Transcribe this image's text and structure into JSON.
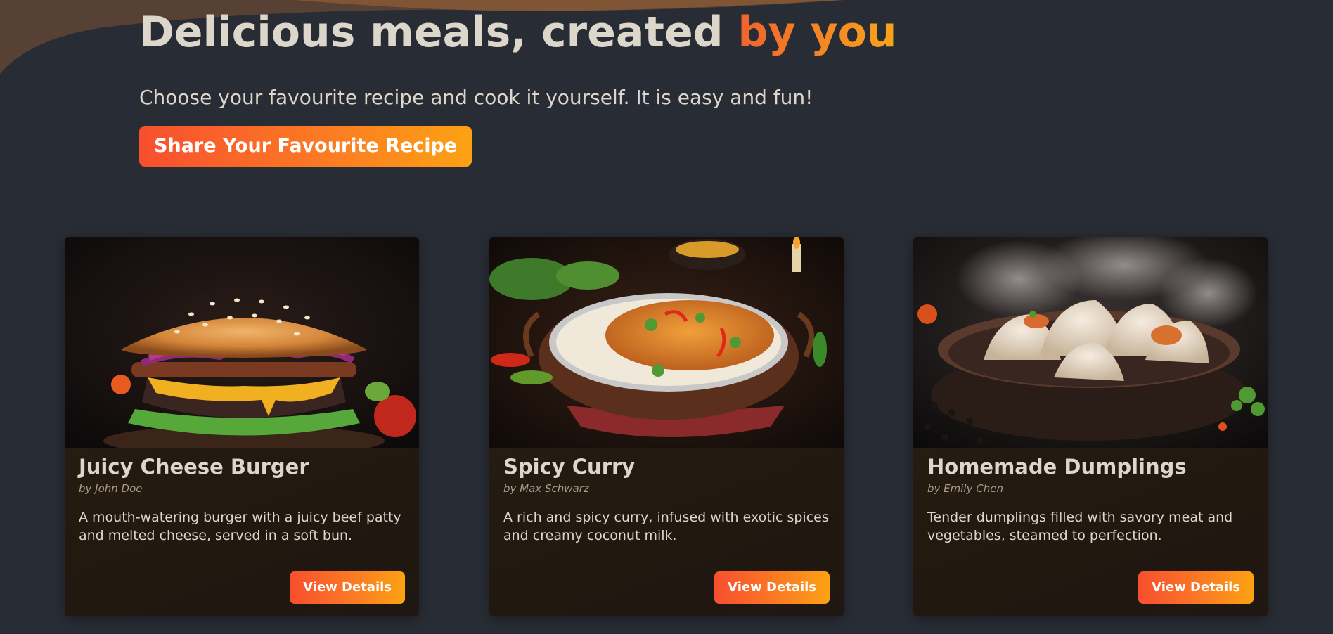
{
  "hero": {
    "title_main": "Delicious meals, created ",
    "title_accent": "by you",
    "subtitle": "Choose your favourite recipe and cook it yourself. It is easy and fun!",
    "cta_label": "Share Your Favourite Recipe"
  },
  "colors": {
    "background": "#282c34",
    "text": "#ddd6cb",
    "accent_start": "#f84f2f",
    "accent_end": "#fca213",
    "wave": "#5a4236"
  },
  "recipes": [
    {
      "title": "Juicy Cheese Burger",
      "author": "by John Doe",
      "description": "A mouth-watering burger with a juicy beef patty and melted cheese, served in a soft bun.",
      "button_label": "View Details",
      "image": "burger-photo"
    },
    {
      "title": "Spicy Curry",
      "author": "by Max Schwarz",
      "description": "A rich and spicy curry, infused with exotic spices and creamy coconut milk.",
      "button_label": "View Details",
      "image": "curry-photo"
    },
    {
      "title": "Homemade Dumplings",
      "author": "by Emily Chen",
      "description": "Tender dumplings filled with savory meat and vegetables, steamed to perfection.",
      "button_label": "View Details",
      "image": "dumplings-photo"
    }
  ]
}
